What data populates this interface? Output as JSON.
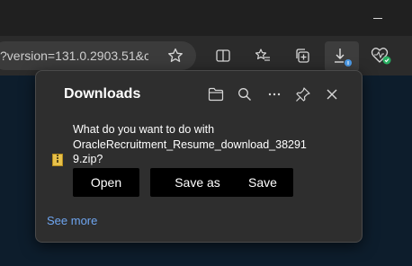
{
  "titlebar": {
    "minimize_icon": "minimize-icon"
  },
  "toolbar": {
    "address_text": "?version=131.0.2903.51&c...",
    "icons": [
      "favorite-star-icon",
      "split-screen-icon",
      "favorites-list-icon",
      "collections-icon",
      "download-icon",
      "browser-essentials-icon"
    ]
  },
  "downloads": {
    "title": "Downloads",
    "header_icons": [
      "folder-icon",
      "search-icon",
      "more-icon",
      "pin-icon",
      "close-icon"
    ],
    "prompt_line1": "What do you want to do with",
    "prompt_line2": "OracleRecruitment_Resume_download_38291",
    "prompt_line3": "9.zip?",
    "open_label": "Open",
    "save_as_label": "Save as",
    "save_label": "Save",
    "see_more_label": "See more"
  },
  "colors": {
    "link": "#6ea5f0",
    "badge_blue": "#4c9be8",
    "badge_green": "#27ae60",
    "zip_yellow": "#e8c14a"
  }
}
